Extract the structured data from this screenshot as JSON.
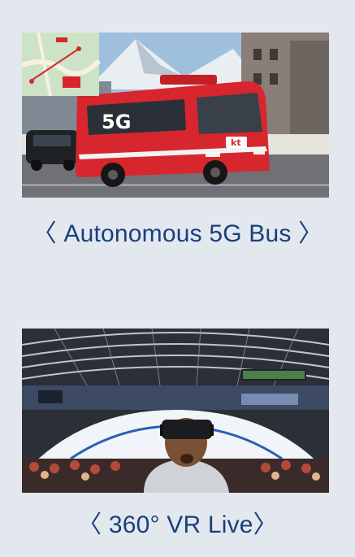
{
  "items": [
    {
      "caption": "〈 Autonomous 5G Bus 〉",
      "photo_alt": "Red 5G autonomous bus with map inset",
      "bus_livery": "5G",
      "bus_logo": "kt"
    },
    {
      "caption": "〈 360° VR Live〉",
      "photo_alt": "Spectator wearing VR headset at speed skating arena"
    }
  ],
  "colors": {
    "caption_text": "#1a3f7c",
    "page_background": "#e3e8ef",
    "bus_red": "#d8262e"
  }
}
